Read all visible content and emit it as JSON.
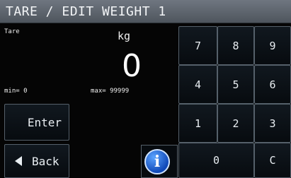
{
  "title": "TARE / EDIT WEIGHT 1",
  "display": {
    "label": "Tare",
    "unit": "kg",
    "value": "0",
    "min": "min= 0",
    "max": "max= 99999"
  },
  "keypad": {
    "k7": "7",
    "k8": "8",
    "k9": "9",
    "k4": "4",
    "k5": "5",
    "k6": "6",
    "k1": "1",
    "k2": "2",
    "k3": "3",
    "k0": "0",
    "clear": "C"
  },
  "actions": {
    "enter": "Enter",
    "back": "Back",
    "info": "i"
  },
  "colors": {
    "background": "#050505",
    "titlebar": "#5f666e",
    "info_button": "#1f6be6"
  }
}
